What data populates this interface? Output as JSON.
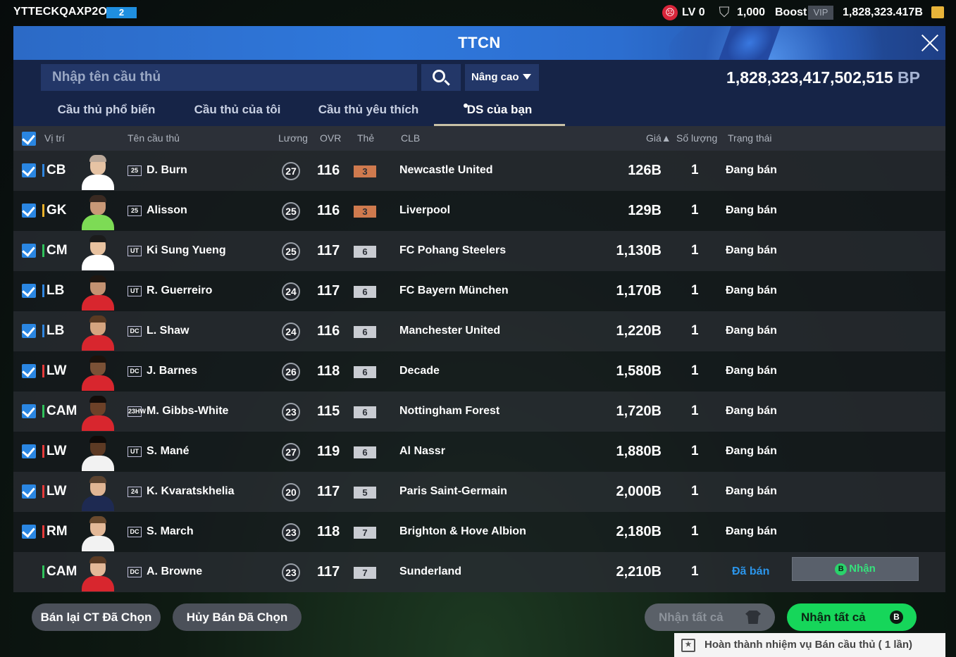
{
  "topbar": {
    "username": "YTTECKQAXP2O9",
    "user_level": "2",
    "lv_label": "LV 0",
    "points": "1,000",
    "boost_label": "Boost",
    "vip_label": "VIP",
    "balance": "1,828,323.417B",
    "icons": [
      "lv-face-icon",
      "shield-icon",
      "coin-icon"
    ]
  },
  "header": {
    "title": "TTCN"
  },
  "search": {
    "placeholder": "Nhập tên cầu thủ",
    "advanced_label": "Nâng cao",
    "bp_value": "1,828,323,417,502,515",
    "bp_unit": "BP"
  },
  "tabs": [
    {
      "label": "Cầu thủ phổ biến"
    },
    {
      "label": "Cầu thủ của tôi"
    },
    {
      "label": "Cầu thủ yêu thích"
    },
    {
      "label": "DS của bạn",
      "active": true
    }
  ],
  "table": {
    "headers": {
      "position": "Vị trí",
      "name": "Tên cầu thủ",
      "salary": "Lương",
      "ovr": "OVR",
      "grade": "Thẻ",
      "club": "CLB",
      "price": "Giá▲",
      "qty": "Số lượng",
      "status": "Trạng thái"
    },
    "rows": [
      {
        "checked": true,
        "position": "CB",
        "pos_color": "#2f86e0",
        "season": "25",
        "name": "D. Burn",
        "salary": "27",
        "ovr": "116",
        "grade": "3",
        "grade_color": "#cf7a4e",
        "club": "Newcastle United",
        "price": "126B",
        "qty": "1",
        "status": "Đang bán"
      },
      {
        "checked": true,
        "position": "GK",
        "pos_color": "#e8b02a",
        "season": "25",
        "name": "Alisson",
        "salary": "25",
        "ovr": "116",
        "grade": "3",
        "grade_color": "#cf7a4e",
        "club": "Liverpool",
        "price": "129B",
        "qty": "1",
        "status": "Đang bán"
      },
      {
        "checked": true,
        "position": "CM",
        "pos_color": "#2fc25a",
        "season": "UT",
        "name": "Ki Sung Yueng",
        "salary": "25",
        "ovr": "117",
        "grade": "6",
        "grade_color": "#c9ccd2",
        "club": "FC Pohang Steelers",
        "price": "1,130B",
        "qty": "1",
        "status": "Đang bán"
      },
      {
        "checked": true,
        "position": "LB",
        "pos_color": "#2f86e0",
        "season": "UT",
        "name": "R. Guerreiro",
        "salary": "24",
        "ovr": "117",
        "grade": "6",
        "grade_color": "#c9ccd2",
        "club": "FC Bayern München",
        "price": "1,170B",
        "qty": "1",
        "status": "Đang bán"
      },
      {
        "checked": true,
        "position": "LB",
        "pos_color": "#2f86e0",
        "season": "DC",
        "name": "L. Shaw",
        "salary": "24",
        "ovr": "116",
        "grade": "6",
        "grade_color": "#c9ccd2",
        "club": "Manchester United",
        "price": "1,220B",
        "qty": "1",
        "status": "Đang bán"
      },
      {
        "checked": true,
        "position": "LW",
        "pos_color": "#e53a3a",
        "season": "DC",
        "name": "J. Barnes",
        "salary": "26",
        "ovr": "118",
        "grade": "6",
        "grade_color": "#c9ccd2",
        "club": "Decade",
        "price": "1,580B",
        "qty": "1",
        "status": "Đang bán"
      },
      {
        "checked": true,
        "position": "CAM",
        "pos_color": "#2fc25a",
        "season": "23HW",
        "name": "M. Gibbs-White",
        "salary": "23",
        "ovr": "115",
        "grade": "6",
        "grade_color": "#c9ccd2",
        "club": "Nottingham Forest",
        "price": "1,720B",
        "qty": "1",
        "status": "Đang bán"
      },
      {
        "checked": true,
        "position": "LW",
        "pos_color": "#e53a3a",
        "season": "UT",
        "name": "S. Mané",
        "salary": "27",
        "ovr": "119",
        "grade": "6",
        "grade_color": "#c9ccd2",
        "club": "Al Nassr",
        "price": "1,880B",
        "qty": "1",
        "status": "Đang bán"
      },
      {
        "checked": true,
        "position": "LW",
        "pos_color": "#e53a3a",
        "season": "24",
        "name": "K. Kvaratskhelia",
        "salary": "20",
        "ovr": "117",
        "grade": "5",
        "grade_color": "#c9ccd2",
        "club": "Paris Saint-Germain",
        "price": "2,000B",
        "qty": "1",
        "status": "Đang bán"
      },
      {
        "checked": true,
        "position": "RM",
        "pos_color": "#e53a3a",
        "season": "DC",
        "name": "S. March",
        "salary": "23",
        "ovr": "118",
        "grade": "7",
        "grade_color": "#c9ccd2",
        "club": "Brighton & Hove Albion",
        "price": "2,180B",
        "qty": "1",
        "status": "Đang bán"
      },
      {
        "checked": false,
        "position": "CAM",
        "pos_color": "#2fc25a",
        "season": "DC",
        "name": "A. Browne",
        "salary": "23",
        "ovr": "117",
        "grade": "7",
        "grade_color": "#c9ccd2",
        "club": "Sunderland",
        "price": "2,210B",
        "qty": "1",
        "status": "Đã bán",
        "sold": true,
        "claim_label": "Nhận"
      }
    ]
  },
  "footer": {
    "resell_label": "Bán lại CT Đã Chọn",
    "cancel_label": "Hủy Bán Đã Chọn",
    "claim_all_disabled_label": "Nhận tất cả",
    "claim_all_label": "Nhận tất cả",
    "mission_text": "Hoàn thành nhiệm vụ Bán cầu thủ ( 1 lần)"
  },
  "colors": {
    "accent": "#2a86e2",
    "claim_green": "#16d65a",
    "sold_blue": "#2b95ea"
  }
}
